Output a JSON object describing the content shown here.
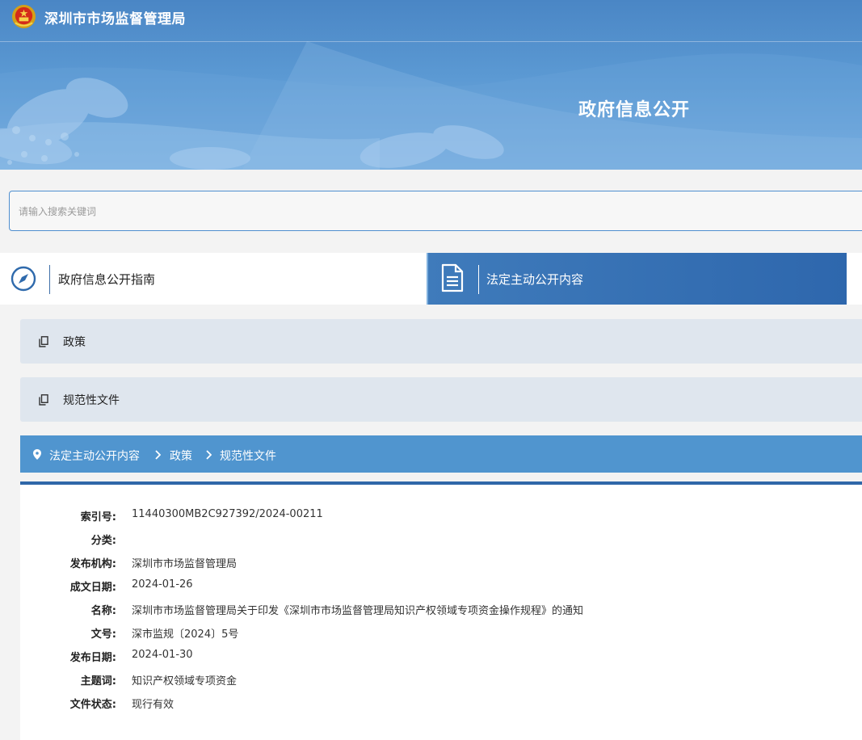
{
  "header": {
    "agency_name": "深圳市市场监督管理局",
    "banner_title": "政府信息公开"
  },
  "search": {
    "placeholder": "请输入搜索关键词"
  },
  "tabs": [
    {
      "label": "政府信息公开指南",
      "icon": "compass-icon",
      "active": false
    },
    {
      "label": "法定主动公开内容",
      "icon": "document-icon",
      "active": true
    }
  ],
  "categories": [
    {
      "label": "政策",
      "icon": "copy-icon"
    },
    {
      "label": "规范性文件",
      "icon": "copy-icon"
    }
  ],
  "breadcrumb": {
    "items": [
      "法定主动公开内容",
      "政策",
      "规范性文件"
    ]
  },
  "document_meta": [
    {
      "label": "索引号:",
      "value": "11440300MB2C927392/2024-00211"
    },
    {
      "label": "分类:",
      "value": ""
    },
    {
      "label": "发布机构:",
      "value": "深圳市市场监督管理局"
    },
    {
      "label": "成文日期:",
      "value": "2024-01-26"
    },
    {
      "label": "名称:",
      "value": "深圳市市场监督管理局关于印发《深圳市市场监督管理局知识产权领域专项资金操作规程》的通知"
    },
    {
      "label": "文号:",
      "value": "深市监规〔2024〕5号"
    },
    {
      "label": "发布日期:",
      "value": "2024-01-30"
    },
    {
      "label": "主题词:",
      "value": "知识产权领域专项资金"
    },
    {
      "label": "文件状态:",
      "value": "现行有效"
    }
  ],
  "colors": {
    "banner_blue": "#4a86c5",
    "active_tab": "#2e67ad",
    "breadcrumb_bar": "#5095cf",
    "category_row": "#dfe6ee"
  }
}
